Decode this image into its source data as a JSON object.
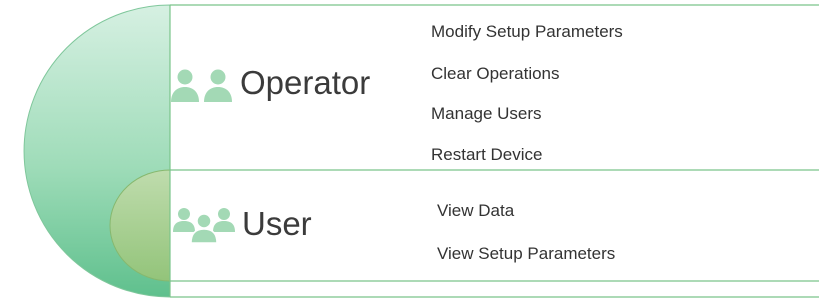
{
  "colors": {
    "outer_semicircle_light": "#d3eee0",
    "outer_semicircle_dark": "#6dc597",
    "inner_semicircle": "#a7d090",
    "panel_border": "#7ac48a",
    "icon_color": "#a3d9b5",
    "text": "#333333"
  },
  "roles": [
    {
      "name": "Operator",
      "icon": "two-persons-icon",
      "permissions": [
        "Modify Setup Parameters",
        "Clear Operations",
        "Manage Users",
        "Restart Device"
      ]
    },
    {
      "name": "User",
      "icon": "three-persons-icon",
      "permissions": [
        "View Data",
        "View Setup Parameters"
      ]
    }
  ]
}
